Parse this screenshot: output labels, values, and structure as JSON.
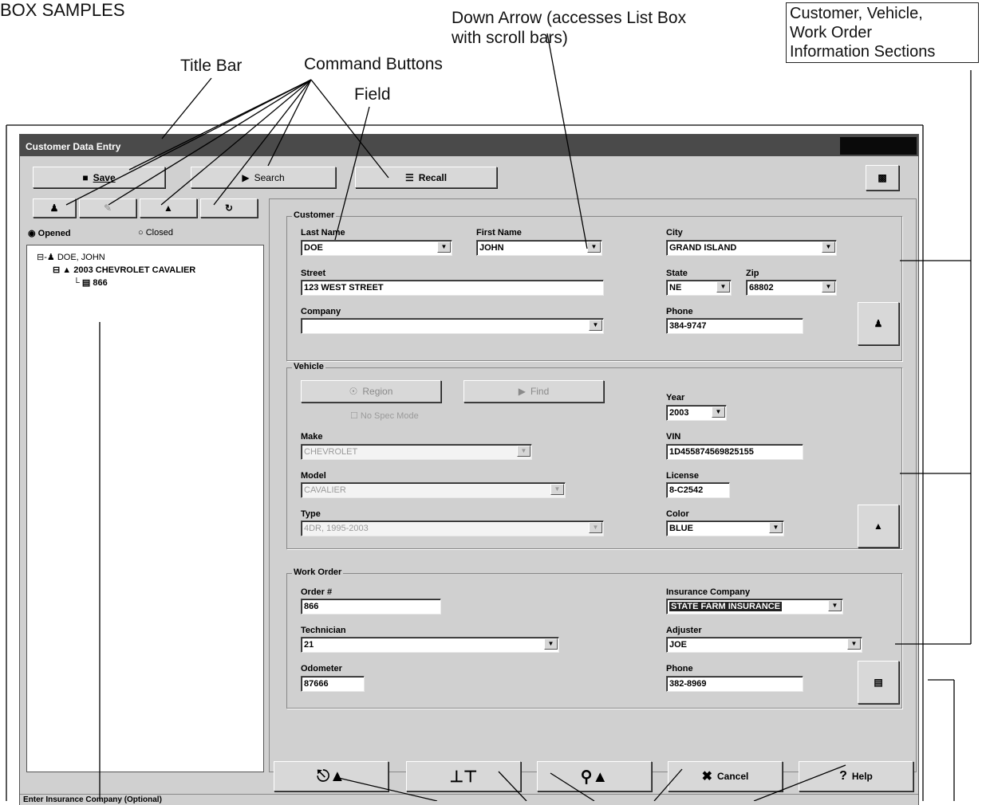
{
  "annotations": {
    "heading": "BOX SAMPLES",
    "down_arrow": "Down Arrow (accesses List Box\nwith scroll bars)",
    "title_bar": "Title Bar",
    "command_buttons": "Command Buttons",
    "field": "Field",
    "sections": "Customer, Vehicle,\nWork Order\nInformation Sections"
  },
  "window": {
    "title": "Customer Data Entry",
    "toolbar": {
      "save": "Save",
      "search": "Search",
      "recall": "Recall"
    },
    "tree_options": {
      "opened": "Opened",
      "closed": "Closed"
    },
    "tree": {
      "customer": "DOE, JOHN",
      "vehicle": "2003 CHEVROLET CAVALIER",
      "order": "866"
    },
    "customer": {
      "section": "Customer",
      "last_name_label": "Last Name",
      "last_name": "DOE",
      "first_name_label": "First Name",
      "first_name": "JOHN",
      "city_label": "City",
      "city": "GRAND ISLAND",
      "street_label": "Street",
      "street": "123 WEST STREET",
      "state_label": "State",
      "state": "NE",
      "zip_label": "Zip",
      "zip": "68802",
      "company_label": "Company",
      "company": "",
      "phone_label": "Phone",
      "phone": "384-9747"
    },
    "vehicle": {
      "section": "Vehicle",
      "region_button": "Region",
      "find_button": "Find",
      "no_spec_mode": "No Spec Mode",
      "year_label": "Year",
      "year": "2003",
      "make_label": "Make",
      "make": "CHEVROLET",
      "vin_label": "VIN",
      "vin": "1D455874569825155",
      "model_label": "Model",
      "model": "CAVALIER",
      "license_label": "License",
      "license": "8-C2542",
      "type_label": "Type",
      "type": "4DR, 1995-2003",
      "color_label": "Color",
      "color": "BLUE"
    },
    "work_order": {
      "section": "Work Order",
      "order_label": "Order #",
      "order": "866",
      "insurance_label": "Insurance Company",
      "insurance": "STATE FARM INSURANCE",
      "technician_label": "Technician",
      "technician": "21",
      "adjuster_label": "Adjuster",
      "adjuster": "JOE",
      "odometer_label": "Odometer",
      "odometer": "87666",
      "phone_label": "Phone",
      "phone": "382-8969"
    },
    "bottom": {
      "cancel": "Cancel",
      "help": "Help"
    },
    "status": "Enter Insurance Company (Optional)"
  }
}
